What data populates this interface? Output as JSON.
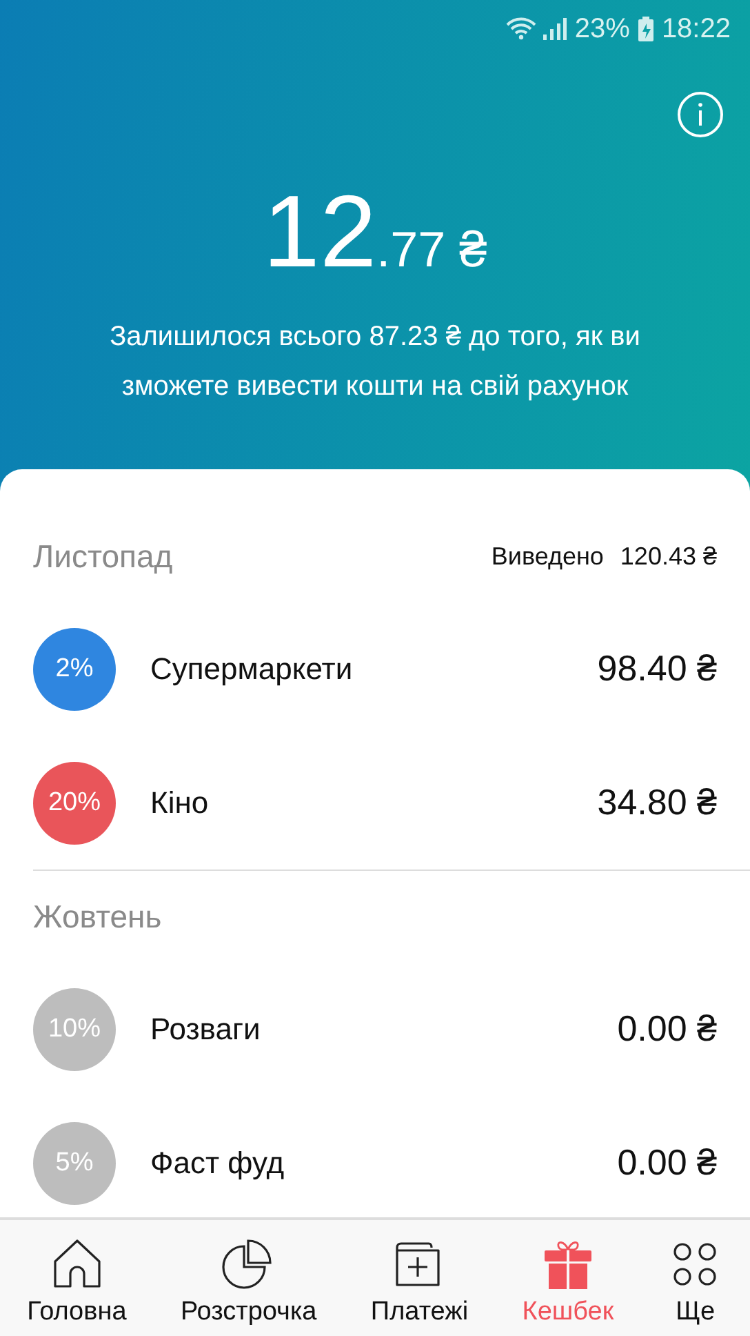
{
  "status_bar": {
    "battery": "23%",
    "time": "18:22"
  },
  "balance": {
    "whole": "12",
    "fraction": ".77 ₴",
    "note": "Залишилося всього 87.23 ₴ до того, як ви зможете вивести кошти на свій рахунок"
  },
  "months": [
    {
      "name": "Листопад",
      "withdrawn_label": "Виведено",
      "withdrawn_amount": "120.43 ₴",
      "items": [
        {
          "percent": "2%",
          "color": "#2f86e0",
          "category": "Супермаркети",
          "amount": "98.40 ₴"
        },
        {
          "percent": "20%",
          "color": "#e9555a",
          "category": "Кіно",
          "amount": "34.80 ₴"
        }
      ]
    },
    {
      "name": "Жовтень",
      "items": [
        {
          "percent": "10%",
          "color": "#bdbdbd",
          "category": "Розваги",
          "amount": "0.00 ₴"
        },
        {
          "percent": "5%",
          "color": "#bdbdbd",
          "category": "Фаст фуд",
          "amount": "0.00 ₴"
        }
      ]
    }
  ],
  "tabs": [
    {
      "label": "Головна",
      "kind": "home",
      "selected": false
    },
    {
      "label": "Розстрочка",
      "kind": "pie",
      "selected": false
    },
    {
      "label": "Платежі",
      "kind": "add",
      "selected": false
    },
    {
      "label": "Кешбек",
      "kind": "gift",
      "selected": true
    },
    {
      "label": "Ще",
      "kind": "more",
      "selected": false
    }
  ]
}
